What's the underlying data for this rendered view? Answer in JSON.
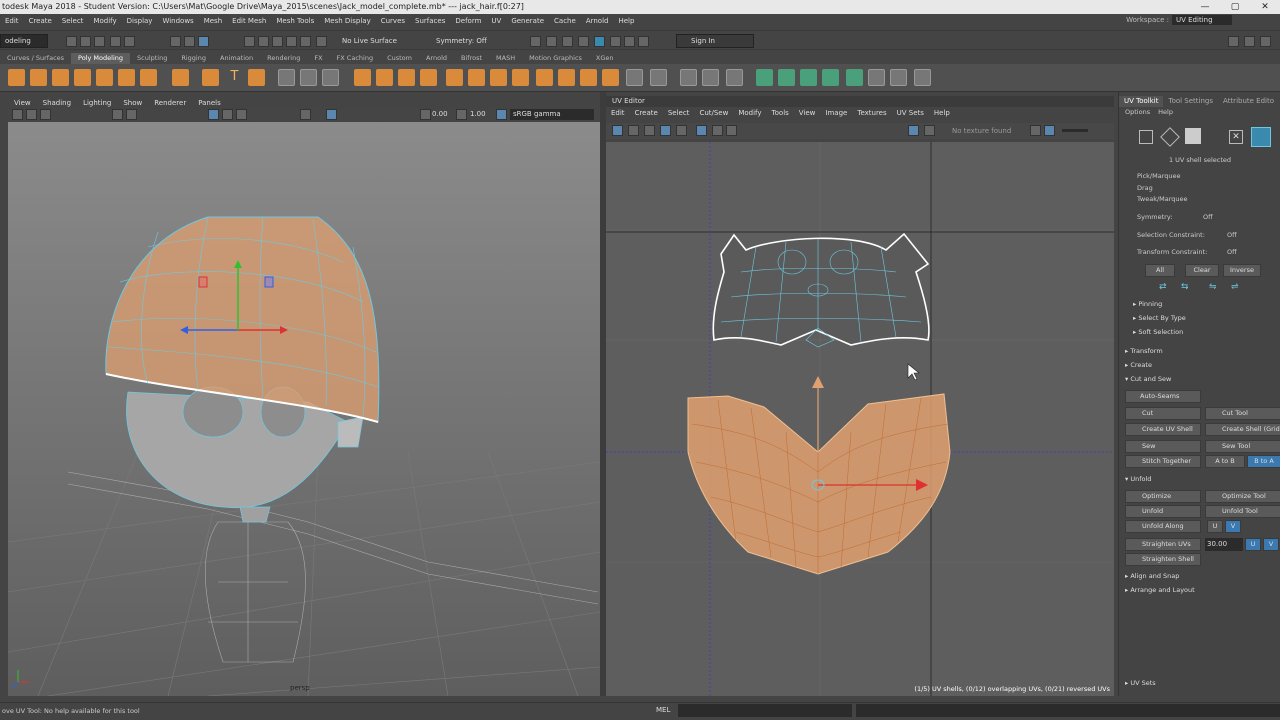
{
  "window": {
    "title": "todesk Maya 2018 - Student Version: C:\\Users\\Mat\\Google Drive\\Maya_2015\\scenes\\Jack_model_complete.mb*  ---  jack_hair.f[0:27]",
    "controls": [
      "—",
      "▢",
      "✕"
    ]
  },
  "menubar": {
    "items": [
      "Edit",
      "Create",
      "Select",
      "Modify",
      "Display",
      "Windows",
      "Mesh",
      "Edit Mesh",
      "Mesh Tools",
      "Mesh Display",
      "Curves",
      "Surfaces",
      "Deform",
      "UV",
      "Generate",
      "Cache",
      "Arnold",
      "Help"
    ],
    "workspace_label": "Workspace :",
    "workspace_value": "UV Editing"
  },
  "statusline": {
    "mode": "odeling",
    "live_surface": "No Live Surface",
    "symmetry": "Symmetry: Off",
    "sign_in": "Sign In"
  },
  "shelf": {
    "tabs": [
      "Curves / Surfaces",
      "Poly Modeling",
      "Sculpting",
      "Rigging",
      "Animation",
      "Rendering",
      "FX",
      "FX Caching",
      "Custom",
      "Arnold",
      "Bifrost",
      "MASH",
      "Motion Graphics",
      "XGen"
    ],
    "active_tab": "Poly Modeling"
  },
  "viewport": {
    "menus": [
      "View",
      "Shading",
      "Lighting",
      "Show",
      "Renderer",
      "Panels"
    ],
    "field_a": "0.00",
    "field_b": "1.00",
    "color_space": "sRGB gamma",
    "camera_label": "persp"
  },
  "uv_editor": {
    "title": "UV Editor",
    "menus": [
      "Edit",
      "Create",
      "Select",
      "Cut/Sew",
      "Modify",
      "Tools",
      "View",
      "Image",
      "Textures",
      "UV Sets",
      "Help"
    ],
    "texture_status": "No texture found",
    "shell_info": "(1/5) UV shells, (0/12) overlapping UVs, (0/21) reversed UVs"
  },
  "uv_toolkit": {
    "tabs": [
      "UV Toolkit",
      "Tool Settings",
      "Attribute Edito"
    ],
    "submenu": [
      "Options",
      "Help"
    ],
    "selection_info": "1 UV shell selected",
    "pick_modes": [
      "Pick/Marquee",
      "Drag",
      "Tweak/Marquee"
    ],
    "symmetry_label": "Symmetry:",
    "symmetry_value": "Off",
    "selection_constraint_label": "Selection Constraint:",
    "selection_constraint_value": "Off",
    "transform_constraint_label": "Transform Constraint:",
    "transform_constraint_value": "Off",
    "select_buttons": [
      "All",
      "Clear",
      "Inverse"
    ],
    "subsections": [
      "Pinning",
      "Select By Type",
      "Soft Selection"
    ],
    "sections": {
      "transform": "Transform",
      "create": "Create",
      "cut_and_sew": "Cut and Sew",
      "unfold": "Unfold",
      "align_and_snap": "Align and Snap",
      "arrange_and_layout": "Arrange and Layout",
      "uv_sets": "UV Sets"
    },
    "cut_sew_tools": {
      "auto_seams": "Auto-Seams",
      "cut": "Cut",
      "cut_tool": "Cut Tool",
      "create_uv_shell": "Create UV Shell",
      "create_shell_grid": "Create Shell (Grid)",
      "sew": "Sew",
      "sew_tool": "Sew Tool",
      "stitch_together": "Stitch Together",
      "a_to_b": "A to B",
      "b_to_a": "B to A"
    },
    "unfold_tools": {
      "optimize": "Optimize",
      "optimize_tool": "Optimize Tool",
      "unfold": "Unfold",
      "unfold_tool": "Unfold Tool",
      "unfold_along": "Unfold Along",
      "u": "U",
      "v": "V",
      "straighten_uvs": "Straighten UVs",
      "straighten_value": "30.00",
      "straighten_shell": "Straighten Shell"
    }
  },
  "bottombar": {
    "help_line": "ove UV Tool: No help available for this tool",
    "mel_label": "MEL"
  },
  "colors": {
    "orange_selection": "#e0a070",
    "wire_cyan": "#6ec8e0",
    "bg_dark": "#444444"
  }
}
